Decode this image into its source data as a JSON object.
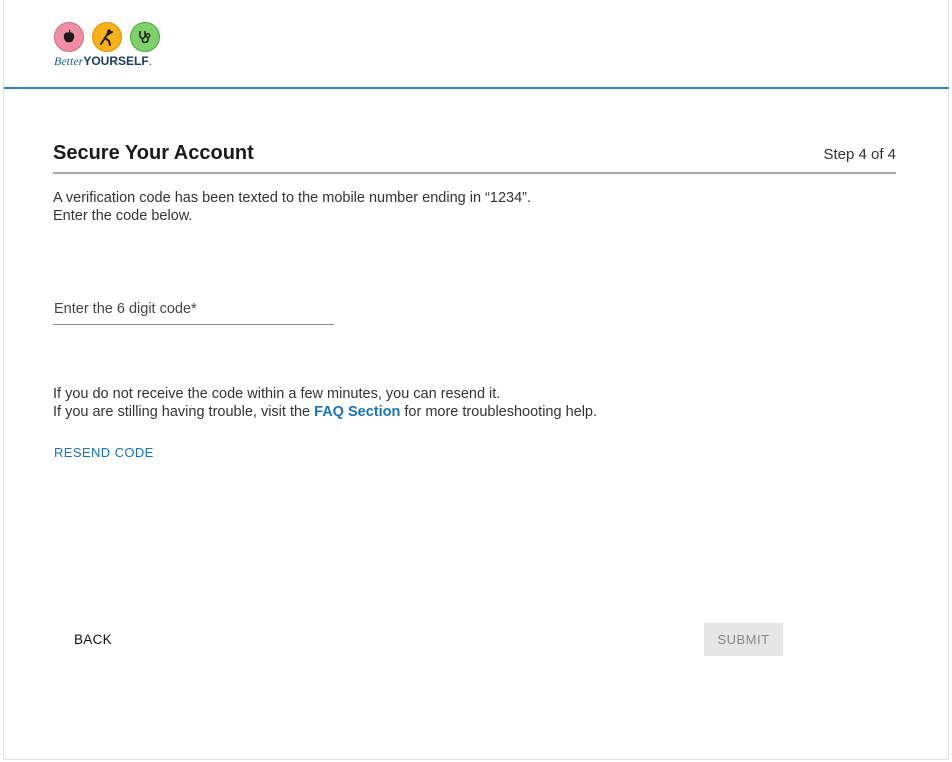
{
  "brand": {
    "name_part1": "Better",
    "name_part2": "YOURSELF",
    "name_dot": ".",
    "icons": [
      "apple-icon",
      "fitness-icon",
      "stethoscope-icon"
    ],
    "colors": {
      "pink": "#f08ea6",
      "orange": "#f8b217",
      "green": "#7ed168",
      "accent": "#2f80c2"
    }
  },
  "page": {
    "title": "Secure Your Account",
    "step": "Step 4 of 4",
    "instructions_line1": "A verification code has been texted to the mobile number ending in “1234”.",
    "instructions_line2": "Enter the code below."
  },
  "form": {
    "code_placeholder": "Enter the 6 digit code*",
    "code_value": ""
  },
  "help": {
    "line1": "If you do not receive the code within a few minutes, you can resend it.",
    "line2_prefix": "If you are stilling having trouble, visit the ",
    "faq_link": "FAQ Section",
    "line2_suffix": " for more troubleshooting help."
  },
  "actions": {
    "resend": "RESEND CODE",
    "back": "BACK",
    "submit": "SUBMIT"
  }
}
